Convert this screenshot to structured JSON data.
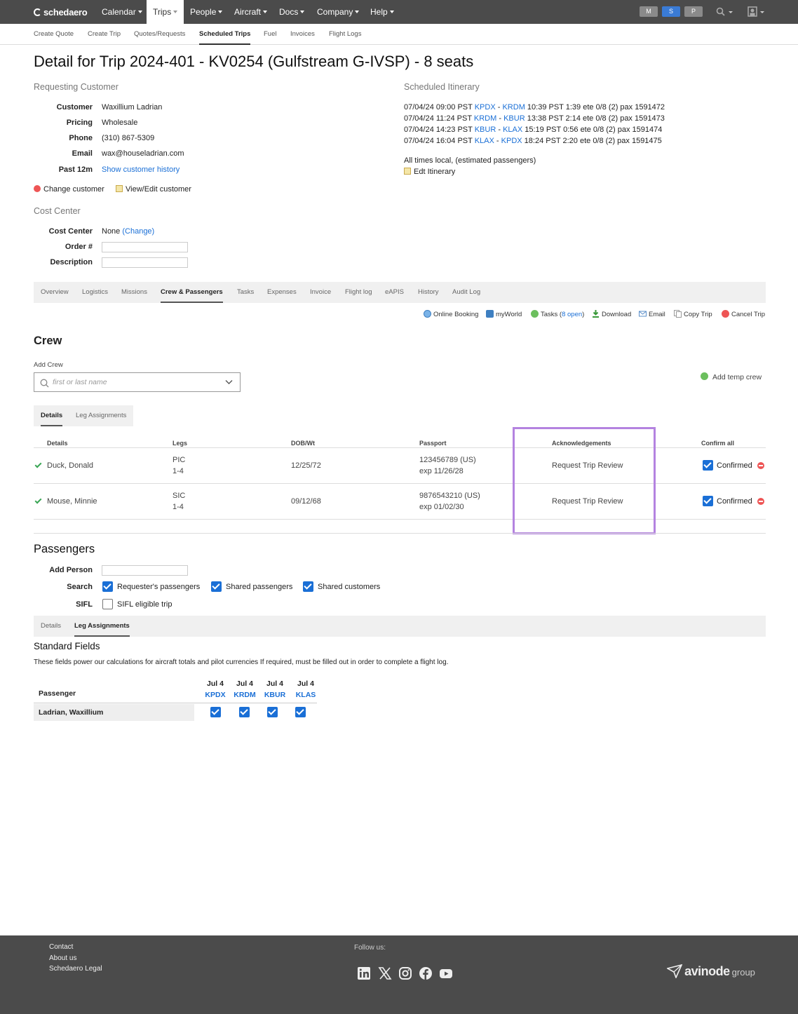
{
  "nav": {
    "brand": "schedaero",
    "items": [
      "Calendar",
      "Trips",
      "People",
      "Aircraft",
      "Docs",
      "Company",
      "Help"
    ],
    "env_buttons": [
      "M",
      "S",
      "P"
    ]
  },
  "subnav": [
    "Create Quote",
    "Create Trip",
    "Quotes/Requests",
    "Scheduled Trips",
    "Fuel",
    "Invoices",
    "Flight Logs"
  ],
  "page_title": "Detail for Trip 2024-401 - KV0254 (Gulfstream G-IVSP) - 8 seats",
  "customer": {
    "heading": "Requesting Customer",
    "labels": {
      "customer": "Customer",
      "pricing": "Pricing",
      "phone": "Phone",
      "email": "Email",
      "past": "Past 12m"
    },
    "customer": "Waxillium Ladrian",
    "pricing": "Wholesale",
    "phone": "(310) 867-5309",
    "email": "wax@houseladrian.com",
    "past": "Show customer history",
    "change": "Change customer",
    "view_edit": "View/Edit customer"
  },
  "cost_center": {
    "heading": "Cost Center",
    "labels": {
      "cost_center": "Cost Center",
      "order": "Order #",
      "description": "Description"
    },
    "value": "None",
    "change": "(Change)"
  },
  "itinerary": {
    "heading": "Scheduled Itinerary",
    "legs": [
      {
        "dep": "07/04/24 09:00 PST",
        "from": "KPDX",
        "to": "KRDM",
        "rest": "10:39 PST 1:39 ete 0/8 (2) pax 1591472"
      },
      {
        "dep": "07/04/24 11:24 PST",
        "from": "KRDM",
        "to": "KBUR",
        "rest": "13:38 PST 2:14 ete 0/8 (2) pax 1591473"
      },
      {
        "dep": "07/04/24 14:23 PST",
        "from": "KBUR",
        "to": "KLAX",
        "rest": "15:19 PST 0:56 ete 0/8 (2) pax 1591474"
      },
      {
        "dep": "07/04/24 16:04 PST",
        "from": "KLAX",
        "to": "KPDX",
        "rest": "18:24 PST 2:20 ete 0/8 (2) pax 1591475"
      }
    ],
    "note": "All times local, (estimated passengers)",
    "edit": "Edt Itinerary"
  },
  "trip_tabs": [
    "Overview",
    "Logistics",
    "Missions",
    "Crew & Passengers",
    "Tasks",
    "Expenses",
    "Invoice",
    "Flight log",
    "eAPIS",
    "History",
    "Audit Log"
  ],
  "actions": {
    "online_booking": "Online Booking",
    "myworld": "myWorld",
    "tasks": "Tasks (",
    "tasks_open": "8 open",
    "tasks_close": ")",
    "download": "Download",
    "email": "Email",
    "copy": "Copy Trip",
    "cancel": "Cancel Trip"
  },
  "crew": {
    "heading": "Crew",
    "add_label": "Add Crew",
    "search_placeholder": "first or last name",
    "add_temp": "Add temp crew",
    "tabs": [
      "Details",
      "Leg Assignments"
    ],
    "columns": [
      "Details",
      "Legs",
      "DOB/Wt",
      "Passport",
      "Acknowledgements",
      "Confirm all"
    ],
    "rows": [
      {
        "name": "Duck, Donald",
        "role": "PIC",
        "legs": "1-4",
        "dob": "12/25/72",
        "passport": "123456789 (US)",
        "exp": "exp 11/26/28",
        "ack": "Request Trip Review",
        "status": "Confirmed"
      },
      {
        "name": "Mouse, Minnie",
        "role": "SIC",
        "legs": "1-4",
        "dob": "09/12/68",
        "passport": "9876543210 (US)",
        "exp": "exp 01/02/30",
        "ack": "Request Trip Review",
        "status": "Confirmed"
      }
    ]
  },
  "passengers": {
    "heading": "Passengers",
    "labels": {
      "add": "Add Person",
      "search": "Search",
      "sifl": "SIFL"
    },
    "search_options": [
      "Requester's passengers",
      "Shared passengers",
      "Shared customers"
    ],
    "sifl_option": "SIFL eligible trip",
    "tabs": [
      "Details",
      "Leg Assignments"
    ],
    "standard_heading": "Standard Fields",
    "standard_desc": "These fields power our calculations for aircraft totals and pilot currencies If required, must be filled out in order to complete a flight log.",
    "col_passenger": "Passenger",
    "legs": [
      {
        "date": "Jul 4",
        "airport": "KPDX"
      },
      {
        "date": "Jul 4",
        "airport": "KRDM"
      },
      {
        "date": "Jul 4",
        "airport": "KBUR"
      },
      {
        "date": "Jul 4",
        "airport": "KLAS"
      }
    ],
    "rows": [
      {
        "name": "Ladrian, Waxillium"
      }
    ]
  },
  "footer": {
    "links": [
      "Contact",
      "About us",
      "Schedaero Legal"
    ],
    "follow": "Follow us:",
    "social": [
      "linkedin-icon",
      "x-icon",
      "instagram-icon",
      "facebook-icon",
      "youtube-icon"
    ],
    "brand": "avinode",
    "brand_suffix": "group"
  },
  "colors": {
    "link": "#1a6fd6",
    "nav_bg": "#4b4b4b",
    "highlight": "#b483e0",
    "confirm": "#3aa655"
  }
}
